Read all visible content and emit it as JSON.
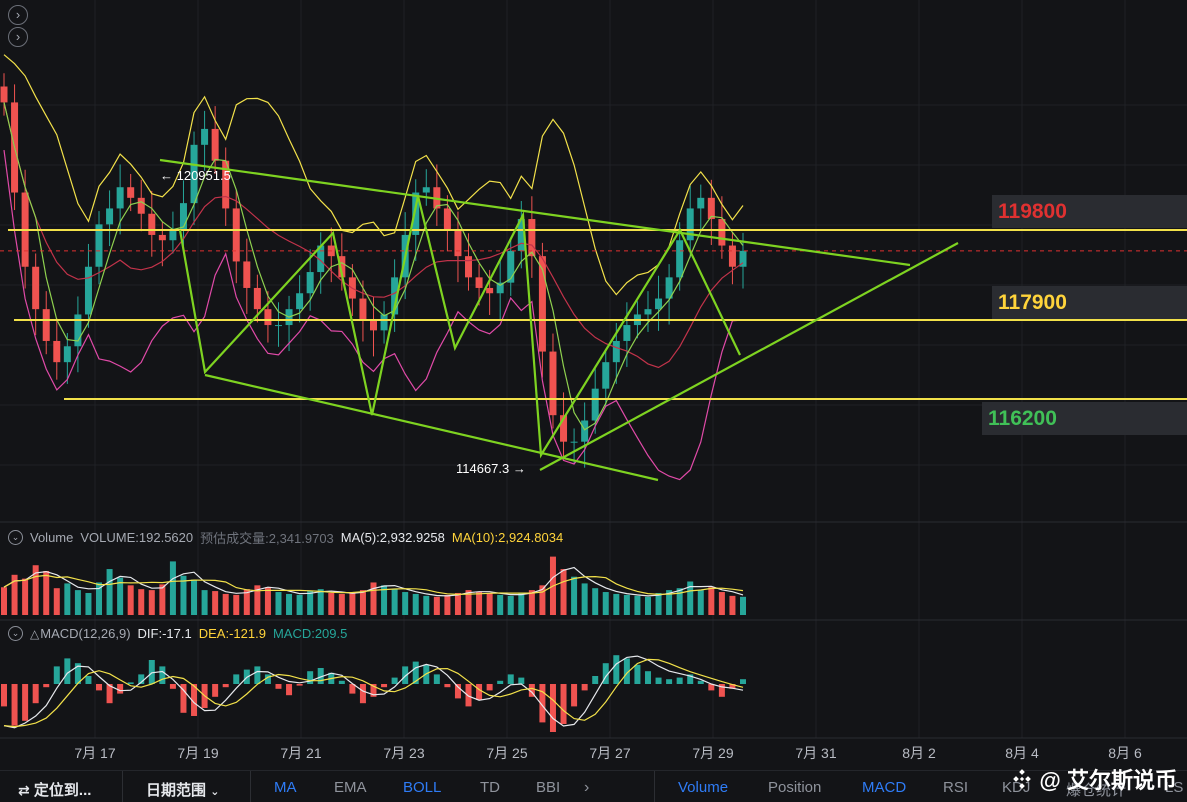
{
  "chart_data": [
    {
      "type": "line",
      "title": "",
      "xlabel": "",
      "ylabel": "",
      "x_tick_labels": [
        "7月 17",
        "7月 19",
        "7月 21",
        "7月 23",
        "7月 25",
        "7月 27",
        "7月 29",
        "7月 31",
        "8月 2",
        "8月 4",
        "8月 6"
      ],
      "ylim": [
        113800,
        122100
      ],
      "price_levels": [
        {
          "value": 119800,
          "label": "119800",
          "color": "#e03131"
        },
        {
          "value": 117900,
          "label": "117900",
          "color": "#ffd43b"
        },
        {
          "value": 116200,
          "label": "116200",
          "color": "#40c057"
        }
      ],
      "current_price_dashed": 118500,
      "annotations": [
        {
          "label": "← 120951.5",
          "value": 120951.5,
          "date": "7月 18"
        },
        {
          "label": "114667.3 →",
          "value": 114667.3,
          "date": "7月 25"
        }
      ],
      "series": [
        {
          "values": [
            121300,
            119600,
            118200,
            117400,
            116800,
            116400,
            116700,
            117300,
            118200,
            119000,
            119300,
            119700,
            119500,
            119200,
            118800,
            118700,
            118900,
            119400,
            120500,
            120800,
            120200,
            119300,
            118300,
            117800,
            117400,
            117100,
            117100,
            117400,
            117700,
            118100,
            118600,
            118400,
            118000,
            117600,
            117200,
            117000,
            117300,
            118000,
            118800,
            119600,
            119700,
            119300,
            118900,
            118400,
            118000,
            117800,
            117700,
            117900,
            118500,
            119100,
            118400,
            116600,
            115400,
            114900,
            114900,
            115300,
            115900,
            116400,
            116800,
            117100,
            117300,
            117400,
            117600,
            118000,
            118700,
            119300,
            119500,
            119100,
            118600,
            118200,
            118500
          ]
        }
      ]
    },
    {
      "type": "bar",
      "title": "Volume",
      "series": [
        {
          "name": "Volume",
          "values": [
            2900,
            4200,
            3800,
            5200,
            4600,
            2800,
            3300,
            2600,
            2300,
            3400,
            4800,
            3900,
            3100,
            2700,
            2600,
            3200,
            5600,
            4100,
            3700,
            2600,
            2500,
            2200,
            2100,
            2700,
            3100,
            2900,
            2400,
            2200,
            2100,
            2500,
            2700,
            2300,
            2200,
            2300,
            2600,
            3400,
            3100,
            2700,
            2400,
            2200,
            2000,
            1900,
            2100,
            2300,
            2600,
            2400,
            2300,
            2100,
            2000,
            2300,
            2600,
            3100,
            6100,
            4800,
            4000,
            3300,
            2800,
            2400,
            2200,
            2100,
            2000,
            1900,
            2300,
            2600,
            2800,
            3500,
            2600,
            2900,
            2400,
            2000,
            1900
          ]
        }
      ],
      "legend": [
        "Volume",
        "VOLUME:192.5620",
        "预估成交量:2,341.9703",
        "MA(5):2,932.9258",
        "MA(10):2,924.8034"
      ]
    },
    {
      "type": "bar",
      "title": "MACD(12,26,9)",
      "series": [
        {
          "name": "MACD",
          "values": [
            -140,
            -260,
            -230,
            -120,
            -20,
            110,
            160,
            130,
            50,
            -40,
            -120,
            -60,
            10,
            60,
            150,
            110,
            -30,
            -180,
            -200,
            -150,
            -80,
            -20,
            60,
            90,
            110,
            60,
            -30,
            -70,
            -10,
            80,
            100,
            70,
            20,
            -60,
            -120,
            -80,
            -20,
            40,
            110,
            140,
            120,
            60,
            -20,
            -90,
            -140,
            -100,
            -40,
            20,
            60,
            40,
            -80,
            -240,
            -300,
            -250,
            -140,
            -40,
            50,
            130,
            180,
            160,
            120,
            80,
            40,
            30,
            40,
            60,
            20,
            -40,
            -80,
            -30,
            30
          ]
        }
      ],
      "legend": [
        "MACD(12,26,9)",
        "DIF:-17.1",
        "DEA:-121.9",
        "MACD:209.5"
      ]
    }
  ],
  "toolbar": {
    "locate": "定位到...",
    "date_range": "日期范围",
    "items": [
      "MA",
      "EMA",
      "BOLL",
      "TD",
      "BBI"
    ],
    "right_items": [
      "Volume",
      "Position",
      "MACD",
      "RSI",
      "KDJ",
      "爆仓统计",
      "LS"
    ]
  },
  "watermark": "@ 艾尔斯说币"
}
